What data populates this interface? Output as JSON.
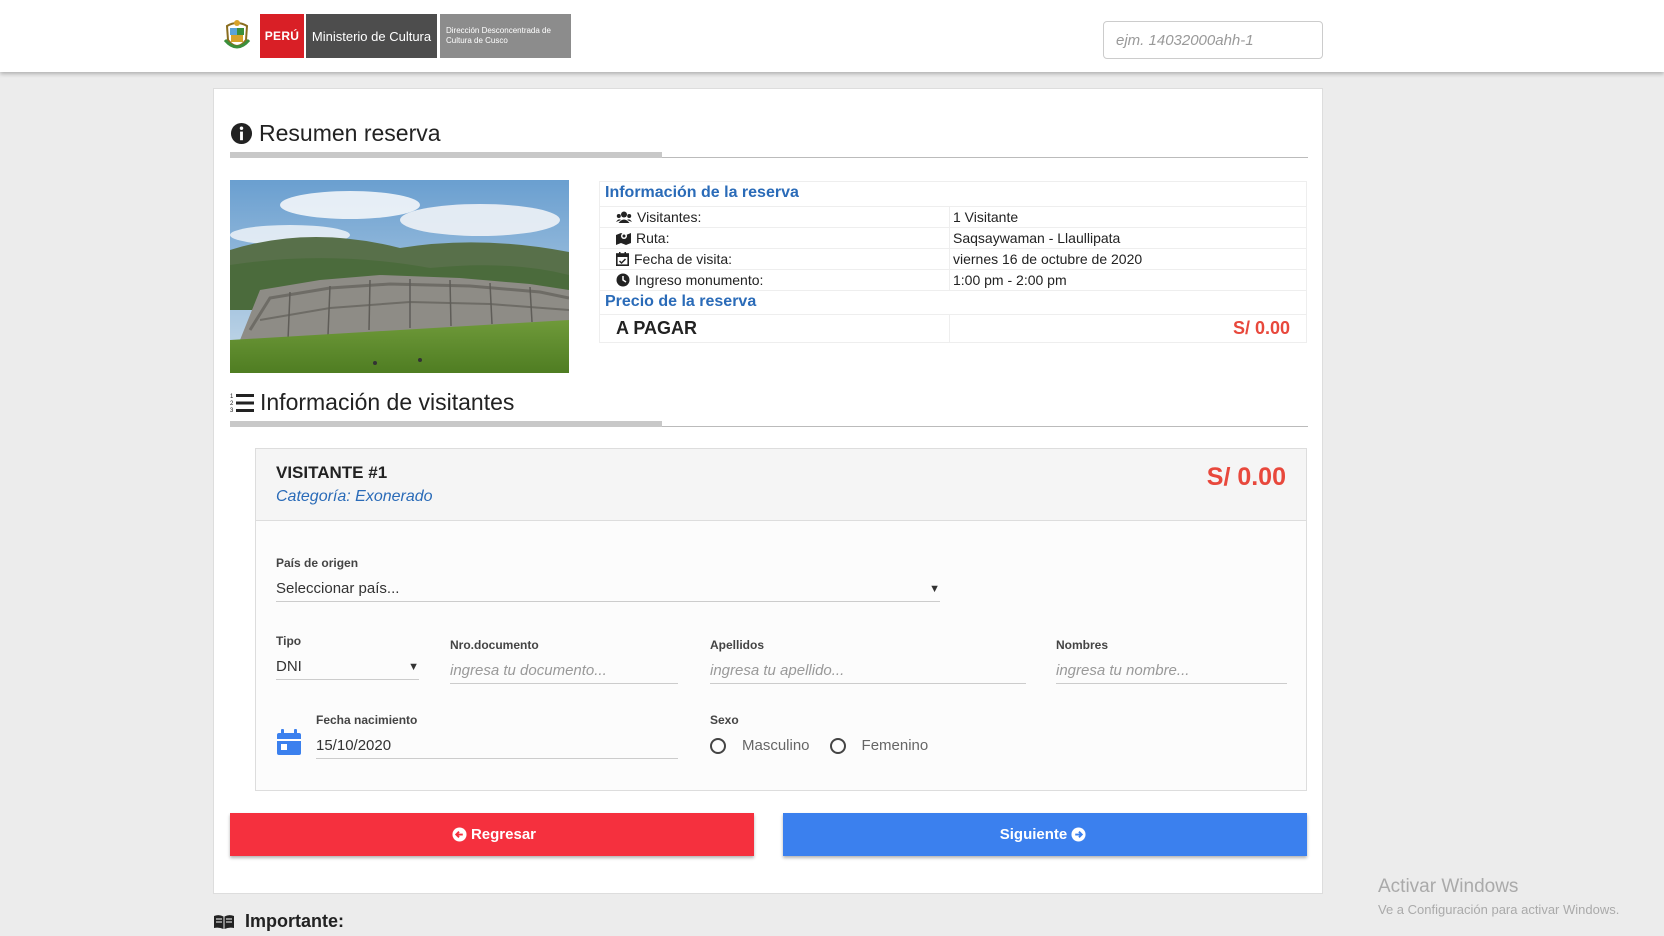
{
  "header": {
    "logo_country": "PERÚ",
    "logo_ministry": "Ministerio de Cultura",
    "logo_direction": "Dirección Desconcentrada de Cultura de Cusco",
    "search_placeholder": "ejm. 14032000ahh-1"
  },
  "summary": {
    "title": "Resumen reserva",
    "info_heading": "Información de la reserva",
    "rows": [
      {
        "icon": "users-icon",
        "label": "Visitantes:",
        "value": "1 Visitante"
      },
      {
        "icon": "route-icon",
        "label": "Ruta:",
        "value": "Saqsaywaman - Llaullipata"
      },
      {
        "icon": "calendar-check-icon",
        "label": "Fecha de visita:",
        "value": "viernes 16 de octubre de 2020"
      },
      {
        "icon": "clock-icon",
        "label": "Ingreso monumento:",
        "value": "1:00 pm - 2:00 pm"
      }
    ],
    "price_heading": "Precio de la reserva",
    "pay_label": "A PAGAR",
    "pay_value": "S/ 0.00"
  },
  "visitors": {
    "title": "Información de visitantes",
    "visitor": {
      "title": "VISITANTE #1",
      "category": "Categoría: Exonerado",
      "price": "S/ 0.00",
      "country_label": "País de origen",
      "country_value": "Seleccionar país...",
      "tipo_label": "Tipo",
      "tipo_value": "DNI",
      "doc_label": "Nro.documento",
      "doc_placeholder": "ingresa tu documento...",
      "apellidos_label": "Apellidos",
      "apellidos_placeholder": "ingresa tu apellido...",
      "nombres_label": "Nombres",
      "nombres_placeholder": "ingresa tu nombre...",
      "birth_label": "Fecha nacimiento",
      "birth_value": "15/10/2020",
      "sexo_label": "Sexo",
      "sexo_options": [
        "Masculino",
        "Femenino"
      ]
    }
  },
  "buttons": {
    "back": "Regresar",
    "next": "Siguiente"
  },
  "important": "Importante:",
  "watermark": {
    "line1": "Activar Windows",
    "line2": "Ve a Configuración para activar Windows."
  },
  "colors": {
    "accent_blue": "#2a6bb8",
    "price_red": "#e8483c",
    "back_button": "#f5303e",
    "next_button": "#3b80ee"
  }
}
